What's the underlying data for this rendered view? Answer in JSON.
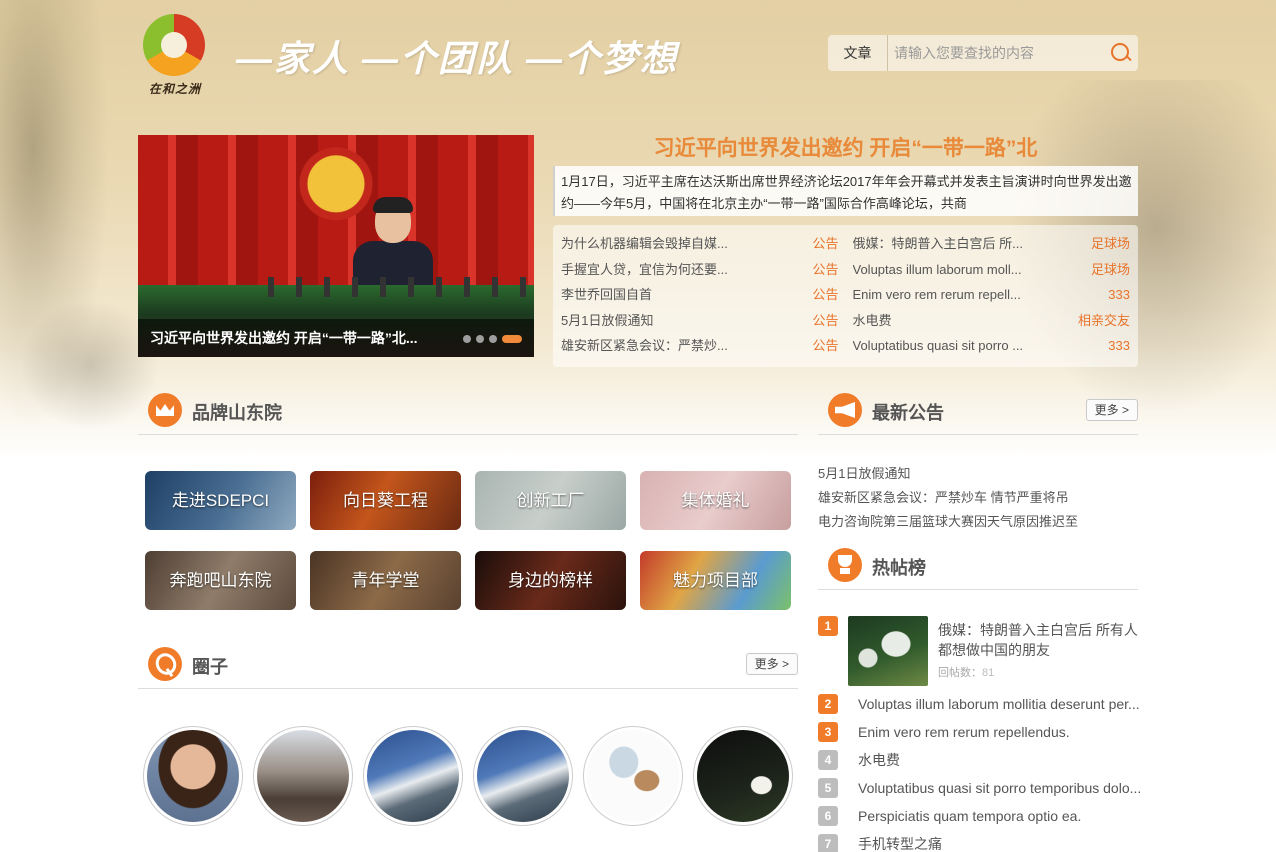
{
  "header": {
    "logo_text": "在和之洲",
    "slogan": "—家人 —个团队 —个梦想",
    "search": {
      "type_label": "文章",
      "placeholder": "请输入您要查找的内容"
    }
  },
  "slider": {
    "caption": "习近平向世界发出邀约 开启“一带一路”北..."
  },
  "headline": {
    "title": "习近平向世界发出邀约 开启“一带一路”北",
    "summary": "1月17日，习近平主席在达沃斯出席世界经济论坛2017年年会开幕式并发表主旨演讲时向世界发出邀约——今年5月，中国将在北京主办“一带一路”国际合作高峰论坛，共商"
  },
  "news": {
    "left": [
      {
        "title": "为什么机器编辑会毁掉自媒...",
        "category": "公告"
      },
      {
        "title": "手握宜人贷，宜信为何还要...",
        "category": "公告"
      },
      {
        "title": "李世乔回国自首",
        "category": "公告"
      },
      {
        "title": "5月1日放假通知",
        "category": "公告"
      },
      {
        "title": "雄安新区紧急会议：严禁炒...",
        "category": "公告"
      }
    ],
    "right": [
      {
        "title": "俄媒：特朗普入主白宫后 所...",
        "category": "足球场"
      },
      {
        "title": "Voluptas illum laborum moll...",
        "category": "足球场"
      },
      {
        "title": "Enim vero rem rerum repell...",
        "category": "333"
      },
      {
        "title": "水电费",
        "category": "相亲交友"
      },
      {
        "title": "Voluptatibus quasi sit porro ...",
        "category": "333"
      }
    ]
  },
  "brand": {
    "title": "品牌山东院",
    "tiles": [
      "走进SDEPCI",
      "向日葵工程",
      "创新工厂",
      "集体婚礼",
      "奔跑吧山东院",
      "青年学堂",
      "身边的榜样",
      "魅力项目部"
    ]
  },
  "circle": {
    "title": "圈子",
    "more": "更多 >"
  },
  "announcements": {
    "title": "最新公告",
    "more": "更多 >",
    "items": [
      "5月1日放假通知",
      "雄安新区紧急会议：严禁炒车 情节严重将吊",
      "电力咨询院第三届篮球大赛因天气原因推迟至"
    ]
  },
  "hot": {
    "title": "热帖榜",
    "first": {
      "rank": "1",
      "title": "俄媒：特朗普入主白宫后 所有人都想做中国的朋友",
      "replies_label": "回帖数：",
      "replies_count": "81"
    },
    "items": [
      {
        "rank": "2",
        "title": "Voluptas illum laborum mollitia deserunt per..."
      },
      {
        "rank": "3",
        "title": "Enim vero rem rerum repellendus."
      },
      {
        "rank": "4",
        "title": "水电费"
      },
      {
        "rank": "5",
        "title": "Voluptatibus quasi sit porro temporibus dolo..."
      },
      {
        "rank": "6",
        "title": "Perspiciatis quam tempora optio ea."
      },
      {
        "rank": "7",
        "title": "手机转型之痛"
      }
    ]
  },
  "colors": {
    "accent": "#f07c2a",
    "headline": "#e88a3a",
    "category": "#e8732a"
  }
}
